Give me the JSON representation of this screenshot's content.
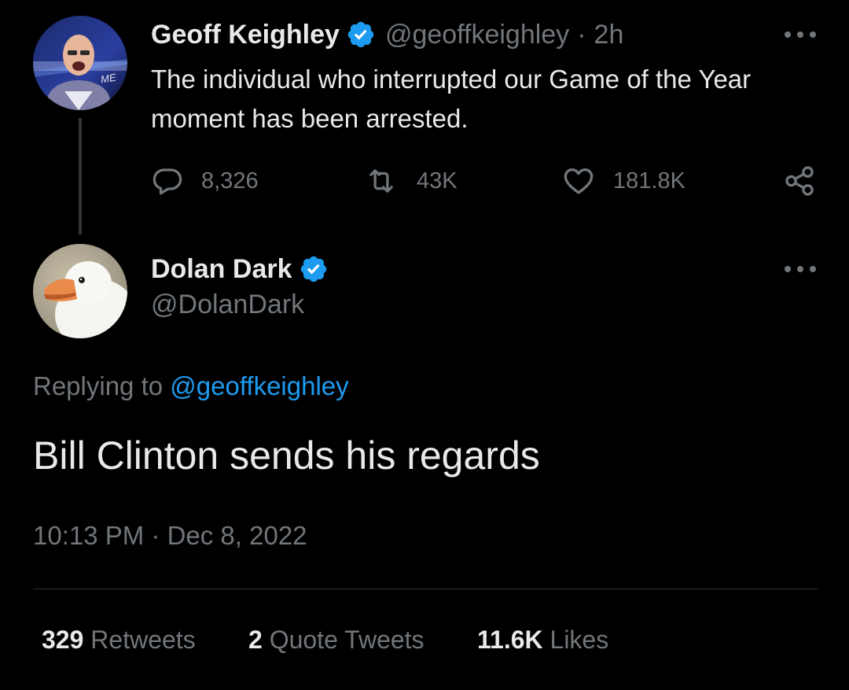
{
  "parent_tweet": {
    "display_name": "Geoff Keighley",
    "handle": "@geoffkeighley",
    "separator": "·",
    "time_ago": "2h",
    "text": "The individual who interrupted our Game of the Year moment has been arrested.",
    "replies": "8,326",
    "retweets": "43K",
    "likes": "181.8K",
    "avatar_icon": "person-avatar",
    "avatar_logo_text": "ME"
  },
  "reply_tweet": {
    "display_name": "Dolan Dark",
    "handle": "@DolanDark",
    "replying_to_label": "Replying to",
    "replying_to_handle": "@geoffkeighley",
    "text": "Bill Clinton sends his regards",
    "timestamp": "10:13 PM · Dec 8, 2022",
    "avatar_icon": "goose-avatar"
  },
  "stats": {
    "retweets_count": "329",
    "retweets_label": "Retweets",
    "quotes_count": "2",
    "quotes_label": "Quote Tweets",
    "likes_count": "11.6K",
    "likes_label": "Likes"
  },
  "colors": {
    "background": "#000000",
    "primary_text": "#e7e9ea",
    "secondary_text": "#71767b",
    "accent": "#1d9bf0",
    "thread_line": "#333639"
  }
}
